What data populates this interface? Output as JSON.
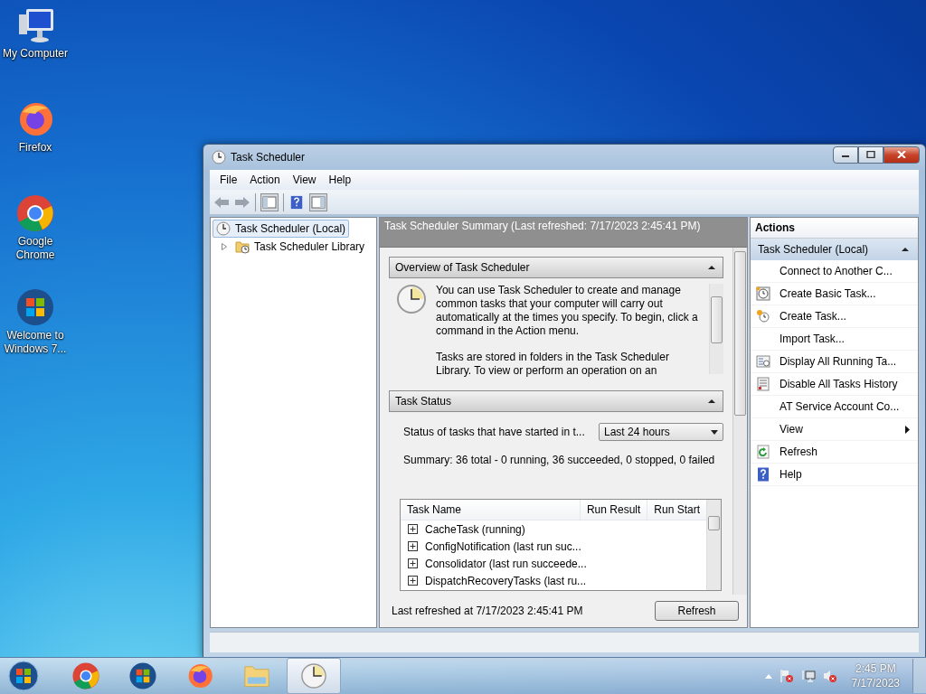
{
  "desktop_icons": [
    {
      "label": "My Computer",
      "kind": "computer"
    },
    {
      "label": "Firefox",
      "kind": "firefox"
    },
    {
      "label": "Google Chrome",
      "kind": "chrome"
    },
    {
      "label": "Welcome to Windows 7...",
      "kind": "windows"
    }
  ],
  "window": {
    "title": "Task Scheduler",
    "menu": [
      "File",
      "Action",
      "View",
      "Help"
    ],
    "tree": [
      {
        "label": "Task Scheduler (Local)",
        "selected": true,
        "children": [
          {
            "label": "Task Scheduler Library",
            "selected": false,
            "expanded": false
          }
        ]
      }
    ],
    "summary": {
      "title": "Task Scheduler Summary (Last refreshed: 7/17/2023 2:45:41 PM)",
      "overview": {
        "title": "Overview of Task Scheduler",
        "expanded": true,
        "paragraphs": [
          "You can use Task Scheduler to create and manage common tasks that your computer will carry out automatically at the times you specify. To begin, click a command in the Action menu.",
          "Tasks are stored in folders in the Task Scheduler Library. To view or perform an operation on an"
        ]
      },
      "task_status": {
        "title": "Task Status",
        "expanded": true,
        "filter_label": "Status of tasks that have started in t...",
        "filter_value": "Last 24 hours",
        "summary": "Summary: 36 total - 0 running, 36 succeeded, 0 stopped, 0 failed",
        "columns": [
          "Task Name",
          "Run Result",
          "Run Start"
        ],
        "rows": [
          {
            "name": "CacheTask (running)",
            "expanded": false
          },
          {
            "name": "ConfigNotification (last run suc...",
            "expanded": false
          },
          {
            "name": "Consolidator (last run succeede...",
            "expanded": false
          },
          {
            "name": "DispatchRecoveryTasks (last ru...",
            "expanded": false
          }
        ]
      },
      "last_refreshed": "Last refreshed at 7/17/2023 2:45:41 PM",
      "refresh_button": "Refresh"
    },
    "actions": {
      "title": "Actions",
      "group": {
        "title": "Task Scheduler (Local)",
        "expanded": true
      },
      "items": [
        {
          "label": "Connect to Another C...",
          "kind": "plain"
        },
        {
          "label": "Create Basic Task...",
          "kind": "basic-task"
        },
        {
          "label": "Create Task...",
          "kind": "create-task"
        },
        {
          "label": "Import Task...",
          "kind": "plain"
        },
        {
          "label": "Display All Running Ta...",
          "kind": "running"
        },
        {
          "label": "Disable All Tasks History",
          "kind": "history"
        },
        {
          "label": "AT Service Account Co...",
          "kind": "plain"
        },
        {
          "label": "View",
          "kind": "submenu"
        },
        {
          "label": "Refresh",
          "kind": "refresh"
        },
        {
          "label": "Help",
          "kind": "help"
        }
      ]
    }
  },
  "taskbar": {
    "items": [
      {
        "kind": "chrome",
        "selected": false
      },
      {
        "kind": "windows",
        "selected": false
      },
      {
        "kind": "firefox",
        "selected": false
      },
      {
        "kind": "explorer",
        "selected": false
      },
      {
        "kind": "clock",
        "selected": true
      }
    ],
    "time": "2:45 PM",
    "date": "7/17/2023"
  }
}
